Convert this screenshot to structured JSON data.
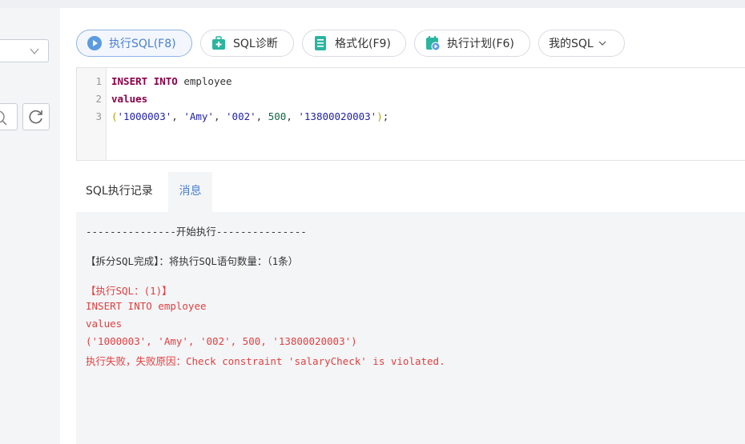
{
  "toolbar": {
    "execute_label": "执行SQL(F8)",
    "diagnose_label": "SQL诊断",
    "format_label": "格式化(F9)",
    "plan_label": "执行计划(F6)",
    "my_sql_label": "我的SQL"
  },
  "editor": {
    "line_numbers": [
      "1",
      "2",
      "3"
    ],
    "line1": {
      "kw1": "INSERT",
      "kw2": "INTO",
      "ident": "employee"
    },
    "line2": {
      "kw": "values"
    },
    "line3": {
      "open": "(",
      "v1": "'1000003'",
      "v2": "'Amy'",
      "v3": "'002'",
      "v4": "500",
      "v5": "'13800020003'",
      "close": ")",
      "end": ";",
      "sep": ", "
    }
  },
  "tabs": {
    "history_label": "SQL执行记录",
    "message_label": "消息"
  },
  "messages": {
    "start": "---------------开始执行---------------",
    "split": "【拆分SQL完成】：将执行SQL语句数量：（1条）",
    "exec_header": "【执行SQL：(1)】",
    "sql_line1": "INSERT INTO employee",
    "sql_line2": "values",
    "sql_line3": "('1000003', 'Amy', '002', 500, '13800020003')",
    "error": "执行失败，失败原因：Check constraint 'salaryCheck' is violated."
  },
  "colors": {
    "accent": "#4a7fd0",
    "error": "#e04040",
    "keyword": "#8b0047",
    "string": "#2222aa",
    "number": "#116644"
  },
  "icons": {
    "execute": "play-circle-icon",
    "diagnose": "medical-kit-icon",
    "format": "document-lines-icon",
    "plan": "calendar-play-icon",
    "dropdown": "chevron-down-icon",
    "search": "search-icon",
    "refresh": "refresh-icon"
  }
}
